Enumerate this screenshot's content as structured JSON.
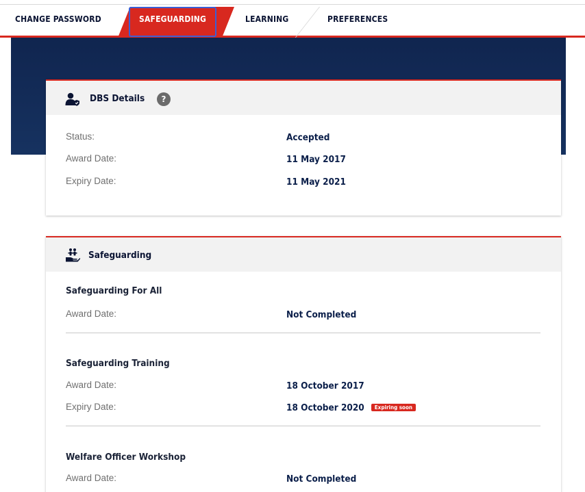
{
  "tabs": [
    {
      "label": "CHANGE PASSWORD",
      "active": false
    },
    {
      "label": "SAFEGUARDING",
      "active": true
    },
    {
      "label": "LEARNING",
      "active": false
    },
    {
      "label": "PREFERENCES",
      "active": false
    }
  ],
  "colors": {
    "accent": "#d8281f",
    "navy": "#10254f",
    "focus": "#3a5fd6"
  },
  "dbs": {
    "icon": "user-shield-icon",
    "title": "DBS Details",
    "help": "?",
    "rows": [
      {
        "label": "Status:",
        "value": "Accepted"
      },
      {
        "label": "Award Date:",
        "value": "11 May 2017"
      },
      {
        "label": "Expiry Date:",
        "value": "11 May 2021"
      }
    ]
  },
  "safeguarding": {
    "icon": "hand-people-icon",
    "title": "Safeguarding",
    "courses": [
      {
        "name": "Safeguarding For All",
        "rows": [
          {
            "label": "Award Date:",
            "value": "Not Completed"
          }
        ]
      },
      {
        "name": "Safeguarding Training",
        "rows": [
          {
            "label": "Award Date:",
            "value": "18 October 2017"
          },
          {
            "label": "Expiry Date:",
            "value": "18 October 2020",
            "badge": "Expiring soon"
          }
        ]
      },
      {
        "name": "Welfare Officer Workshop",
        "rows": [
          {
            "label": "Award Date:",
            "value": "Not Completed"
          }
        ]
      }
    ]
  }
}
